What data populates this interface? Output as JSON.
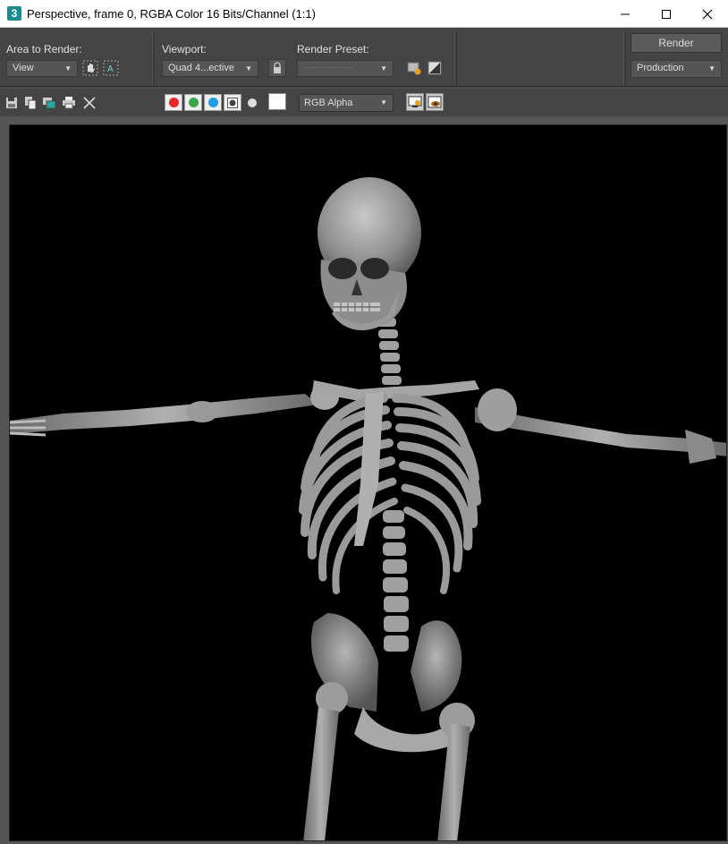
{
  "window": {
    "app_icon_text": "3",
    "title": "Perspective, frame 0, RGBA Color 16 Bits/Channel (1:1)",
    "minimize_glyph": "—",
    "maximize_glyph": "☐",
    "close_glyph": "✕"
  },
  "controls": {
    "area_label": "Area to Render:",
    "area_value": "View",
    "viewport_label": "Viewport:",
    "viewport_value": "Quad 4...ective",
    "preset_label": "Render Preset:",
    "preset_value": "------------------------",
    "render_label": "Render",
    "mode_value": "Production"
  },
  "toolbar": {
    "channel_select_value": "RGB Alpha",
    "channel_colors": {
      "red": "#e8262a",
      "green": "#3aa84a",
      "blue": "#1e9ee8"
    }
  },
  "colors": {
    "panel_bg": "#444444",
    "render_bg": "#000000",
    "bone": "#9a9a9a"
  }
}
